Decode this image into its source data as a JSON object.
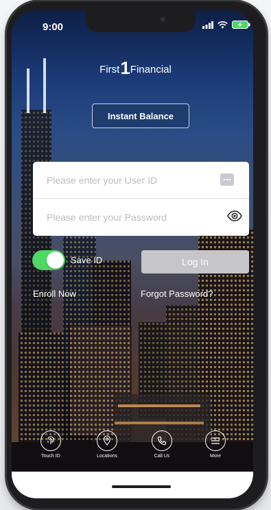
{
  "status": {
    "time": "9:00"
  },
  "brand": {
    "left": "First",
    "mid": "1",
    "right": "Financial"
  },
  "instant_balance": {
    "label": "Instant Balance"
  },
  "login_form": {
    "user_id_placeholder": "Please enter your User ID",
    "password_placeholder": "Please enter your Password"
  },
  "save_id": {
    "label": "Save ID",
    "enabled": true
  },
  "login_button": {
    "label": "Log In"
  },
  "links": {
    "enroll": "Enroll Now",
    "forgot": "Forgot Password?"
  },
  "bottom_nav": {
    "items": [
      {
        "label": "Touch ID",
        "icon": "fingerprint-icon"
      },
      {
        "label": "Locations",
        "icon": "location-icon"
      },
      {
        "label": "Call Us",
        "icon": "phone-icon"
      },
      {
        "label": "More",
        "icon": "menu-icon"
      }
    ]
  },
  "colors": {
    "accent_toggle": "#4cd964",
    "button_dark": "#1e3c6e",
    "login_disabled": "#c6c6c8"
  }
}
